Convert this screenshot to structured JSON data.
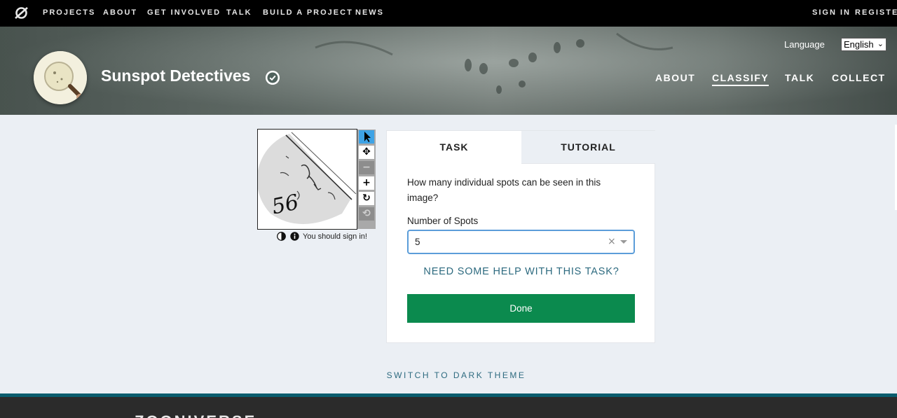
{
  "topnav": {
    "links": [
      "PROJECTS",
      "ABOUT",
      "GET INVOLVED",
      "TALK",
      "BUILD A PROJECT",
      "NEWS"
    ],
    "sign_in": "SIGN IN",
    "register": "REGISTER"
  },
  "project": {
    "title": "Sunspot Detectives",
    "language_label": "Language",
    "language_value": "English",
    "nav": [
      "ABOUT",
      "CLASSIFY",
      "TALK",
      "COLLECT"
    ],
    "active_nav": "CLASSIFY"
  },
  "viewer": {
    "subject_text": "56",
    "signin_note": "You should sign in!",
    "tools": [
      "pointer-icon",
      "move-icon",
      "zoom-out-icon",
      "zoom-in-icon",
      "rotate-icon",
      "reset-icon"
    ]
  },
  "task": {
    "tabs": [
      "TASK",
      "TUTORIAL"
    ],
    "question": "How many individual spots can be seen in this image?",
    "field_label": "Number of Spots",
    "selected_value": "5",
    "help_link": "NEED SOME HELP WITH THIS TASK?",
    "done_label": "Done"
  },
  "theme_toggle": "SWITCH TO DARK THEME",
  "footer": {
    "brand": "ZOONIVERSE"
  },
  "colors": {
    "done_green": "#0b8a4e",
    "link_teal": "#2d6a7f",
    "focus_blue": "#5b9dd9",
    "footer_band": "#0a5d6e"
  }
}
